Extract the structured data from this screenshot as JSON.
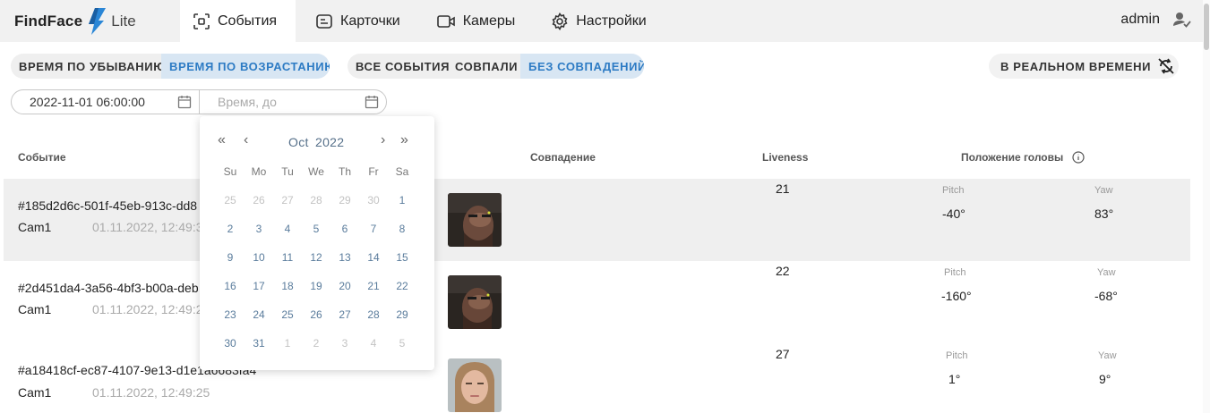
{
  "app": {
    "logo": "FindFace",
    "logo_sub": "Lite"
  },
  "nav": [
    {
      "label": "События",
      "icon": "events-icon"
    },
    {
      "label": "Карточки",
      "icon": "cards-icon"
    },
    {
      "label": "Камеры",
      "icon": "camera-icon"
    },
    {
      "label": "Настройки",
      "icon": "settings-icon"
    }
  ],
  "user": {
    "name": "admin"
  },
  "sort": [
    "ВРЕМЯ ПО УБЫВАНИЮ",
    "ВРЕМЯ ПО ВОЗРАСТАНИЮ"
  ],
  "event_filter": [
    "ВСЕ СОБЫТИЯ",
    "СОВПАЛИ",
    "БЕЗ СОВПАДЕНИЙ"
  ],
  "realtime": "В РЕАЛЬНОМ ВРЕМЕНИ",
  "date_from": {
    "value": "2022-11-01 06:00:00"
  },
  "date_to": {
    "placeholder": "Время, до"
  },
  "table": {
    "headers": {
      "event": "Событие",
      "match": "Совпадение",
      "liveness": "Liveness",
      "head": "Положение головы"
    },
    "pitch_label": "Pitch",
    "yaw_label": "Yaw",
    "rows": [
      {
        "id": "#185d2d6c-501f-45eb-913c-dd8",
        "camera": "Cam1",
        "time": "01.11.2022, 12:49:3",
        "liveness": "21",
        "pitch": "-40°",
        "yaw": "83°"
      },
      {
        "id": "#2d451da4-3a56-4bf3-b00a-deb",
        "camera": "Cam1",
        "time": "01.11.2022, 12:49:2",
        "liveness": "22",
        "pitch": "-160°",
        "yaw": "-68°"
      },
      {
        "id": "#a18418cf-ec87-4107-9e13-d1e1a6683fa4",
        "camera": "Cam1",
        "time": "01.11.2022, 12:49:25",
        "liveness": "27",
        "pitch": "1°",
        "yaw": "9°"
      }
    ]
  },
  "calendar": {
    "month": "Oct",
    "year": "2022",
    "nav": {
      "prev_year": "«",
      "prev_month": "‹",
      "next_month": "›",
      "next_year": "»"
    },
    "weekdays": [
      "Su",
      "Mo",
      "Tu",
      "We",
      "Th",
      "Fr",
      "Sa"
    ],
    "weeks": [
      [
        "25",
        "26",
        "27",
        "28",
        "29",
        "30",
        "1"
      ],
      [
        "2",
        "3",
        "4",
        "5",
        "6",
        "7",
        "8"
      ],
      [
        "9",
        "10",
        "11",
        "12",
        "13",
        "14",
        "15"
      ],
      [
        "16",
        "17",
        "18",
        "19",
        "20",
        "21",
        "22"
      ],
      [
        "23",
        "24",
        "25",
        "26",
        "27",
        "28",
        "29"
      ],
      [
        "30",
        "31",
        "1",
        "2",
        "3",
        "4",
        "5"
      ]
    ]
  }
}
